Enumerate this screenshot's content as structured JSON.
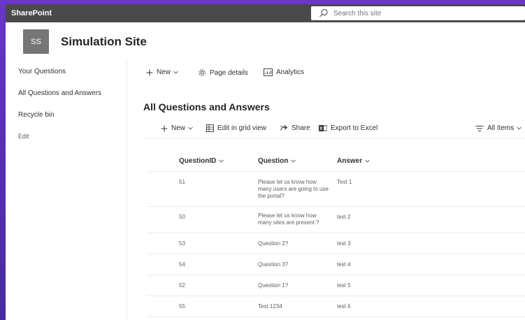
{
  "app": {
    "brand": "SharePoint"
  },
  "search": {
    "placeholder": "Search this site"
  },
  "site": {
    "logo_text": "SS",
    "title": "Simulation Site"
  },
  "nav": {
    "items": [
      {
        "label": "Your Questions"
      },
      {
        "label": "All Questions and Answers"
      },
      {
        "label": "Recycle bin"
      },
      {
        "label": "Edit"
      }
    ]
  },
  "page_toolbar": {
    "new": "New",
    "page_details": "Page details",
    "analytics": "Analytics"
  },
  "list": {
    "title": "All Questions and Answers",
    "commands": {
      "new": "New",
      "edit_grid": "Edit in grid view",
      "share": "Share",
      "export": "Export to Excel",
      "view": "All Items"
    },
    "columns": [
      "QuestionID",
      "Question",
      "Answer"
    ],
    "rows": [
      {
        "id": "51",
        "question": "Please let us know how many users are going to use the portal?",
        "answer": "Test 1"
      },
      {
        "id": "50",
        "question": "Please let us know how many sites are present ?",
        "answer": "test 2"
      },
      {
        "id": "53",
        "question": "Question 2?",
        "answer": "test 3"
      },
      {
        "id": "54",
        "question": "Question 3?",
        "answer": "test 4"
      },
      {
        "id": "52",
        "question": "Question 1?",
        "answer": "test 5"
      },
      {
        "id": "55",
        "question": "Test 1234",
        "answer": "test 6"
      }
    ]
  },
  "colors": {
    "suite_bar": "#4a4a4a",
    "background": "#6a36c9",
    "logo": "#767676"
  }
}
